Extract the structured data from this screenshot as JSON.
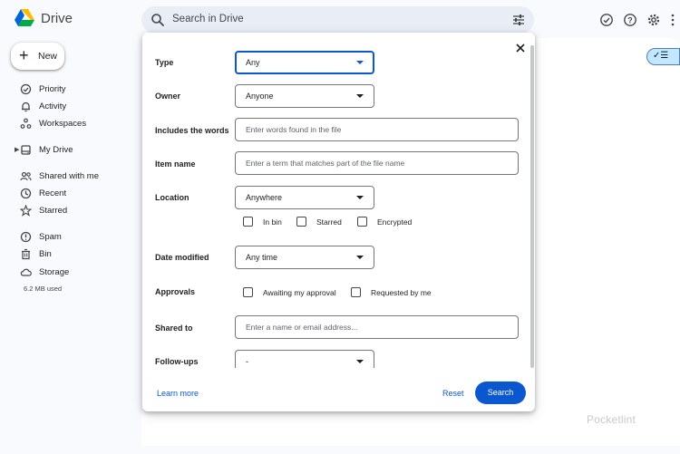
{
  "app": {
    "brand": "Drive",
    "search_placeholder": "Search in Drive"
  },
  "sidebar": {
    "new_label": "New",
    "items": [
      {
        "label": "Priority",
        "icon": "priority-icon"
      },
      {
        "label": "Activity",
        "icon": "bell-icon"
      },
      {
        "label": "Workspaces",
        "icon": "workspaces-icon"
      },
      {
        "label": "My Drive",
        "icon": "my-drive-icon"
      },
      {
        "label": "Shared with me",
        "icon": "people-icon"
      },
      {
        "label": "Recent",
        "icon": "clock-icon"
      },
      {
        "label": "Starred",
        "icon": "star-icon"
      },
      {
        "label": "Spam",
        "icon": "spam-icon"
      },
      {
        "label": "Bin",
        "icon": "bin-icon"
      },
      {
        "label": "Storage",
        "icon": "cloud-icon"
      }
    ],
    "storage_used": "6.2 MB used"
  },
  "dialog": {
    "type": {
      "label": "Type",
      "value": "Any"
    },
    "owner": {
      "label": "Owner",
      "value": "Anyone"
    },
    "includes_words": {
      "label": "Includes the words",
      "placeholder": "Enter words found in the file"
    },
    "item_name": {
      "label": "Item name",
      "placeholder": "Enter a term that matches part of the file name"
    },
    "location": {
      "label": "Location",
      "value": "Anywhere",
      "options": [
        "In bin",
        "Starred",
        "Encrypted"
      ]
    },
    "date_modified": {
      "label": "Date modified",
      "value": "Any time"
    },
    "approvals": {
      "label": "Approvals",
      "options": [
        "Awaiting my approval",
        "Requested by me"
      ]
    },
    "shared_to": {
      "label": "Shared to",
      "placeholder": "Enter a name or email address..."
    },
    "follow_ups": {
      "label": "Follow-ups",
      "value": "-"
    },
    "learn_more": "Learn more",
    "reset": "Reset",
    "search": "Search"
  },
  "watermark": "Pocketlint",
  "colors": {
    "accent": "#0b57d0",
    "background": "#f8fafd",
    "search_bg": "#e9eef6",
    "toggle_bg": "#c2e7ff"
  }
}
